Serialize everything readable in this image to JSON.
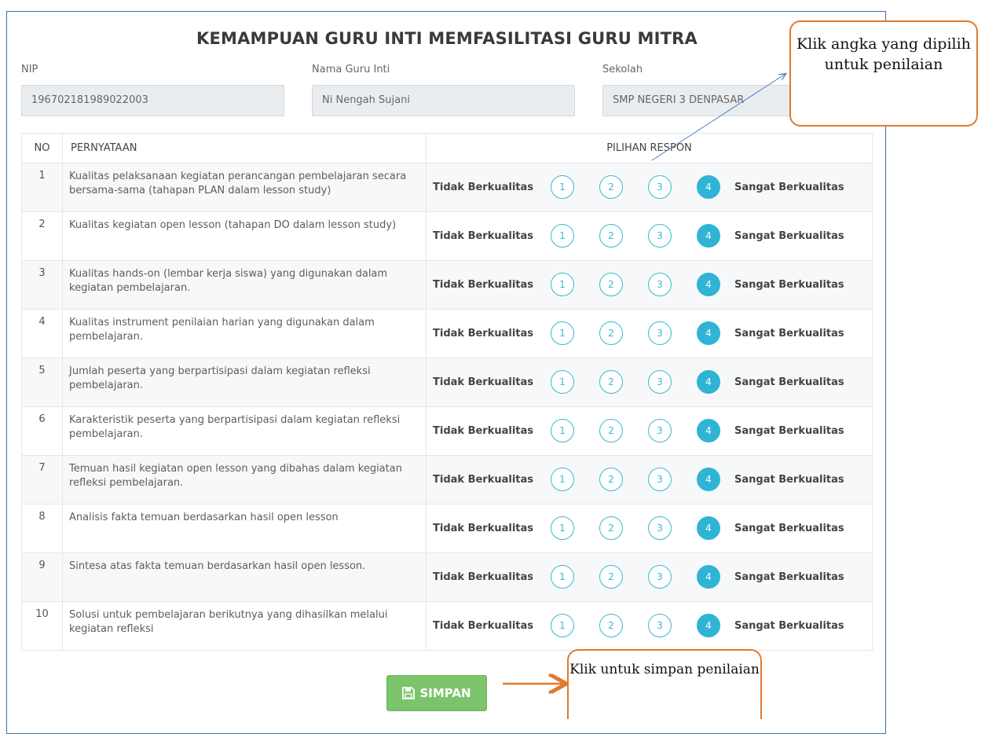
{
  "form": {
    "title": "KEMAMPUAN GURU INTI MEMFASILITASI GURU MITRA",
    "nip_label": "NIP",
    "nip_value": "196702181989022003",
    "nama_label": "Nama Guru Inti",
    "nama_value": "Ni Nengah Sujani",
    "sekolah_label": "Sekolah",
    "sekolah_value": "SMP NEGERI 3 DENPASAR"
  },
  "table": {
    "headers": {
      "no": "NO",
      "statement": "PERNYATAAN",
      "response": "PILIHAN RESPON"
    },
    "low_label": "Tidak Berkualitas",
    "high_label": "Sangat Berkualitas",
    "options": [
      "1",
      "2",
      "3",
      "4"
    ],
    "rows": [
      {
        "no": "1",
        "text": "Kualitas pelaksanaan kegiatan perancangan pembelajaran secara bersama-sama (tahapan PLAN dalam lesson study)",
        "selected": 4
      },
      {
        "no": "2",
        "text": "Kualitas kegiatan open lesson (tahapan DO dalam lesson study)",
        "selected": 4
      },
      {
        "no": "3",
        "text": "Kualitas hands-on (lembar kerja siswa) yang digunakan dalam kegiatan pembelajaran.",
        "selected": 4
      },
      {
        "no": "4",
        "text": "Kualitas instrument penilaian harian yang digunakan dalam pembelajaran.",
        "selected": 4
      },
      {
        "no": "5",
        "text": "Jumlah peserta yang berpartisipasi dalam kegiatan refleksi pembelajaran.",
        "selected": 4
      },
      {
        "no": "6",
        "text": "Karakteristik peserta yang berpartisipasi dalam kegiatan refleksi pembelajaran.",
        "selected": 4
      },
      {
        "no": "7",
        "text": "Temuan hasil kegiatan open lesson yang dibahas dalam kegiatan refleksi pembelajaran.",
        "selected": 4
      },
      {
        "no": "8",
        "text": "Analisis fakta temuan berdasarkan hasil open lesson",
        "selected": 4
      },
      {
        "no": "9",
        "text": "Sintesa atas fakta temuan berdasarkan hasil open lesson.",
        "selected": 4
      },
      {
        "no": "10",
        "text": "Solusi untuk pembelajaran berikutnya yang dihasilkan melalui kegiatan refleksi",
        "selected": 4
      }
    ]
  },
  "save_button": {
    "label": "SIMPAN",
    "icon": "floppy-disk-icon"
  },
  "annotations": {
    "top": "Klik angka yang dipilih untuk penilaian",
    "bottom": "Klik untuk simpan penilaian"
  },
  "colors": {
    "accent": "#2fb4d5",
    "save_green": "#7cc46b",
    "callout_border": "#e07a2e",
    "panel_border": "#3f6fb3"
  }
}
